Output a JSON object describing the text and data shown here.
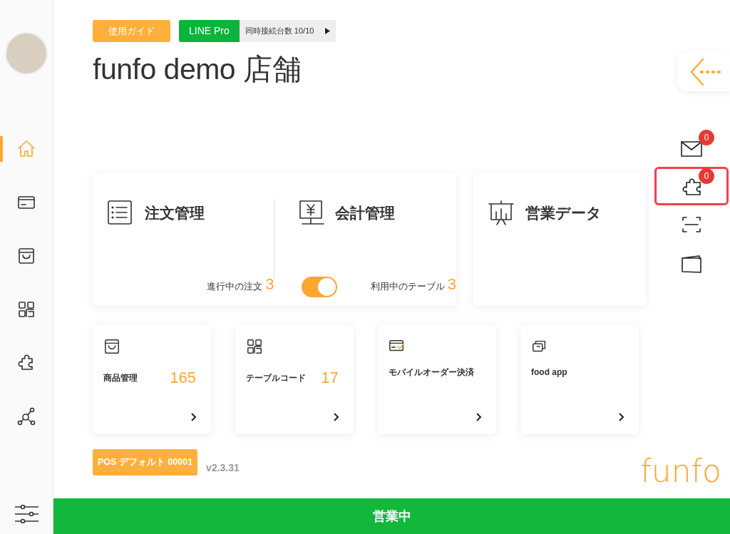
{
  "sidebar": {
    "items": [
      {
        "kind": "home",
        "selected": true
      },
      {
        "kind": "card",
        "selected": false
      },
      {
        "kind": "bag",
        "selected": false
      },
      {
        "kind": "qr",
        "selected": false
      },
      {
        "kind": "puzzle",
        "selected": false
      },
      {
        "kind": "network",
        "selected": false
      }
    ]
  },
  "header": {
    "guide_button": "使用ガイド",
    "plan": "LINE Pro",
    "devices": "同時接続台数 10/10",
    "title": "funfo demo 店舗"
  },
  "side_tools": [
    {
      "kind": "mail",
      "badge": "0",
      "highlighted": false
    },
    {
      "kind": "puzzle",
      "badge": "0",
      "highlighted": true
    },
    {
      "kind": "scan",
      "highlighted": false
    },
    {
      "kind": "wallet",
      "highlighted": false
    }
  ],
  "main_cards": [
    {
      "kind": "orders",
      "title": "注文管理",
      "footer_label": "進行中の注文",
      "count": "3"
    },
    {
      "kind": "checkout",
      "title": "会計管理",
      "footer_label": "利用中のテーブル",
      "count": "3",
      "toggle_on": true
    },
    {
      "kind": "sales",
      "title": "営業データ"
    }
  ],
  "tiles": [
    {
      "kind": "bag",
      "title": "商品管理",
      "count": "165"
    },
    {
      "kind": "qr",
      "title": "テーブルコード",
      "count": "17"
    },
    {
      "kind": "card-check",
      "title": "モバイルオーダー決済"
    },
    {
      "kind": "tickets",
      "title": "food app"
    }
  ],
  "footer": {
    "pos_button": "POS デフォルト 00001",
    "version": "v2.3.31",
    "logo": "funfo"
  },
  "status_bar": {
    "label": "営業中"
  }
}
